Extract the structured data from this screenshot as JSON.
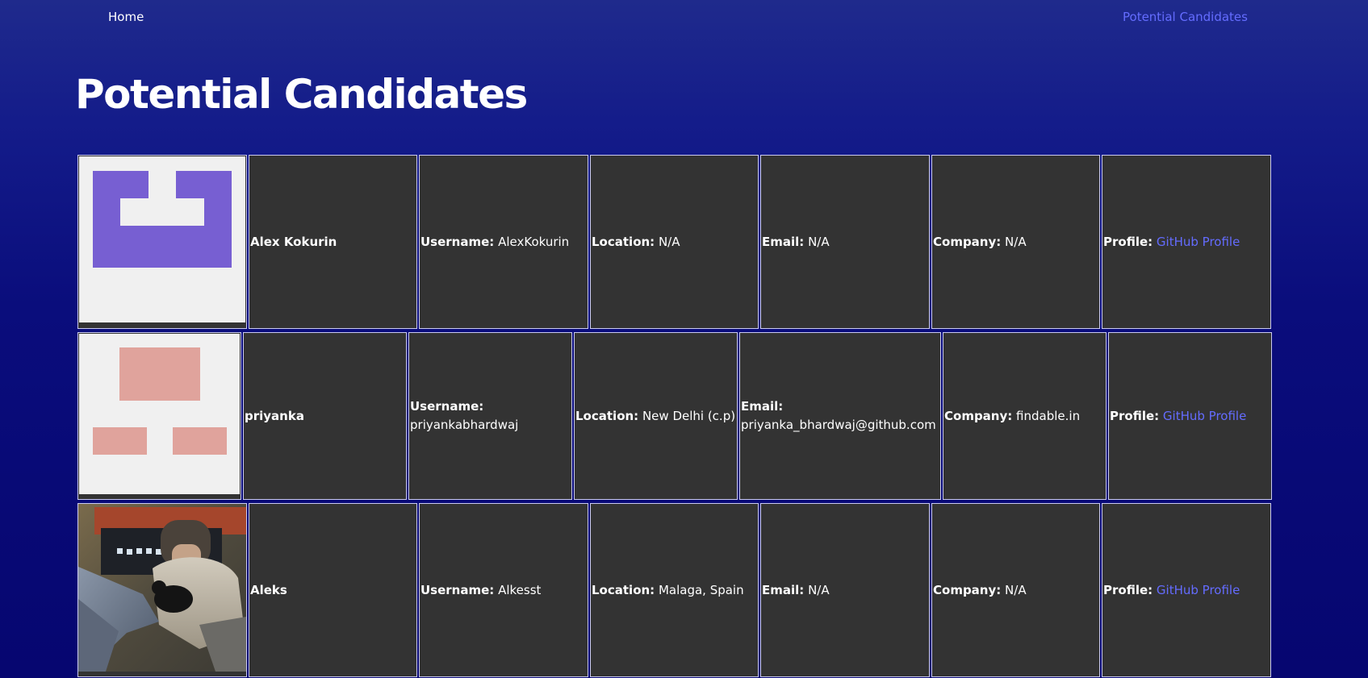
{
  "nav": {
    "home_label": "Home",
    "candidates_label": "Potential Candidates"
  },
  "page": {
    "title": "Potential Candidates"
  },
  "labels": {
    "username": "Username:",
    "location": "Location:",
    "email": "Email:",
    "company": "Company:",
    "profile": "Profile:"
  },
  "candidates": [
    {
      "name": "Alex Kokurin",
      "username": "AlexKokurin",
      "location": "N/A",
      "email": "N/A",
      "company": "N/A",
      "profile_link": "GitHub Profile",
      "avatar": "identicon-purple"
    },
    {
      "name": "priyanka",
      "username": "priyankabhardwaj",
      "location": "New Delhi (c.p)",
      "email": "priyanka_bhardwaj@github.com",
      "company": "findable.in",
      "profile_link": "GitHub Profile",
      "avatar": "identicon-pink"
    },
    {
      "name": "Aleks",
      "username": "Alkesst",
      "location": "Malaga, Spain",
      "email": "N/A",
      "company": "N/A",
      "profile_link": "GitHub Profile",
      "avatar": "photo-person-with-cat"
    }
  ],
  "colors": {
    "accent": "#646cff",
    "cell_bg": "#333333",
    "identicon_purple": "#775fd2",
    "identicon_pink": "#e0a39c"
  }
}
